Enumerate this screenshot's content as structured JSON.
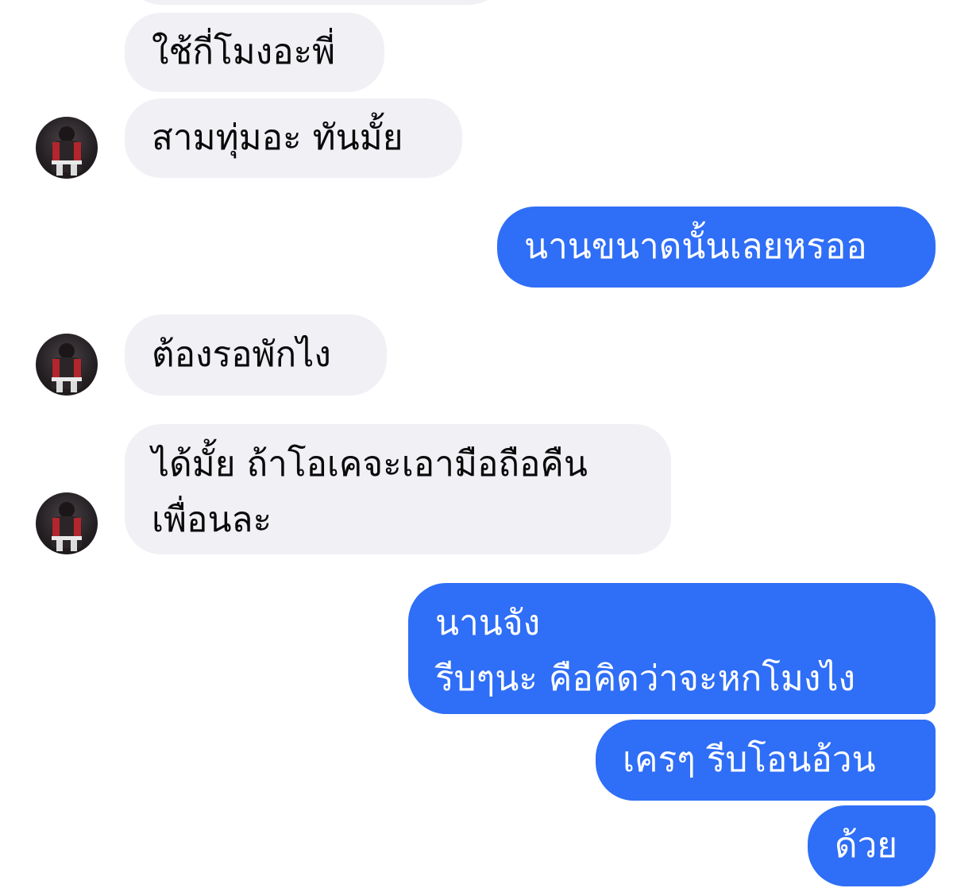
{
  "conversation": {
    "incoming_color": "#f0f0f5",
    "outgoing_color": "#2f6ef6",
    "messages": [
      {
        "sender": "other",
        "text": "ใช้กี่โมงอะพี่"
      },
      {
        "sender": "other",
        "text": "สามทุ่มอะ ทันมั้ย"
      },
      {
        "sender": "me",
        "text": "นานขนาดนั้นเลยหรออ"
      },
      {
        "sender": "other",
        "text": "ต้องรอพักไง"
      },
      {
        "sender": "other",
        "lines": [
          "ได้มั้ย ถ้าโอเคจะเอามือถือคืน",
          "เพื่อนละ"
        ]
      },
      {
        "sender": "me",
        "lines": [
          "นานจัง",
          "รีบๆนะ คือคิดว่าจะหกโมงไง"
        ]
      },
      {
        "sender": "me",
        "text": "เครๆ รีบโอนอ้วน"
      },
      {
        "sender": "me",
        "text": "ด้วย"
      }
    ],
    "avatar_icon": "user-avatar"
  }
}
